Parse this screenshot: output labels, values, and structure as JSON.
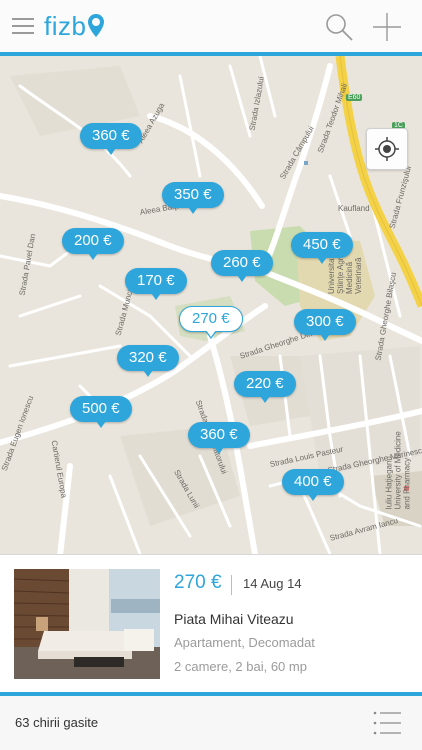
{
  "header": {
    "logo_text": "fizb",
    "accent_color": "#2ea6db",
    "icons": [
      "menu-icon",
      "search-icon",
      "plus-icon"
    ]
  },
  "map": {
    "streets": [
      "Strada Izlazului",
      "Strada Câmpului",
      "Aleea Azuga",
      "Aleea Băiţa",
      "Strada Pavel Dan",
      "Strada Muncitorilor",
      "Strada Gheorghe Dima",
      "Strada Observatorului",
      "Strada Louis Pasteur",
      "Strada Gheorghe Marinescu",
      "Cartierul Europa",
      "Strada Eugen Ionescu",
      "Strada Lunii",
      "Universitatea de Ştiinţe Agricole şi Medicină Veterinară",
      "Iuliu Haţieganu University of Medicine and Pharmacy",
      "Kaufland",
      "Strada Teodor Mihali",
      "Strada Frunzişului",
      "Strada Gheorghe Bilaşcu",
      "Strada Avram Iancu"
    ],
    "road_badges": [
      "E60",
      "1C"
    ],
    "pins": [
      {
        "label": "360 €",
        "selected": false
      },
      {
        "label": "350 €",
        "selected": false
      },
      {
        "label": "200 €",
        "selected": false
      },
      {
        "label": "450 €",
        "selected": false
      },
      {
        "label": "260 €",
        "selected": false
      },
      {
        "label": "170 €",
        "selected": false
      },
      {
        "label": "270 €",
        "selected": true
      },
      {
        "label": "300 €",
        "selected": false
      },
      {
        "label": "320 €",
        "selected": false
      },
      {
        "label": "220 €",
        "selected": false
      },
      {
        "label": "500 €",
        "selected": false
      },
      {
        "label": "360 €",
        "selected": false
      },
      {
        "label": "400 €",
        "selected": false
      }
    ]
  },
  "listing": {
    "price": "270 €",
    "date": "14 Aug 14",
    "title": "Piata Mihai Viteazu",
    "type": "Apartament,  Decomadat",
    "details": "2 camere, 2 bai,  60 mp"
  },
  "footer": {
    "count_text": "63 chirii gasite",
    "icon": "list-icon"
  }
}
